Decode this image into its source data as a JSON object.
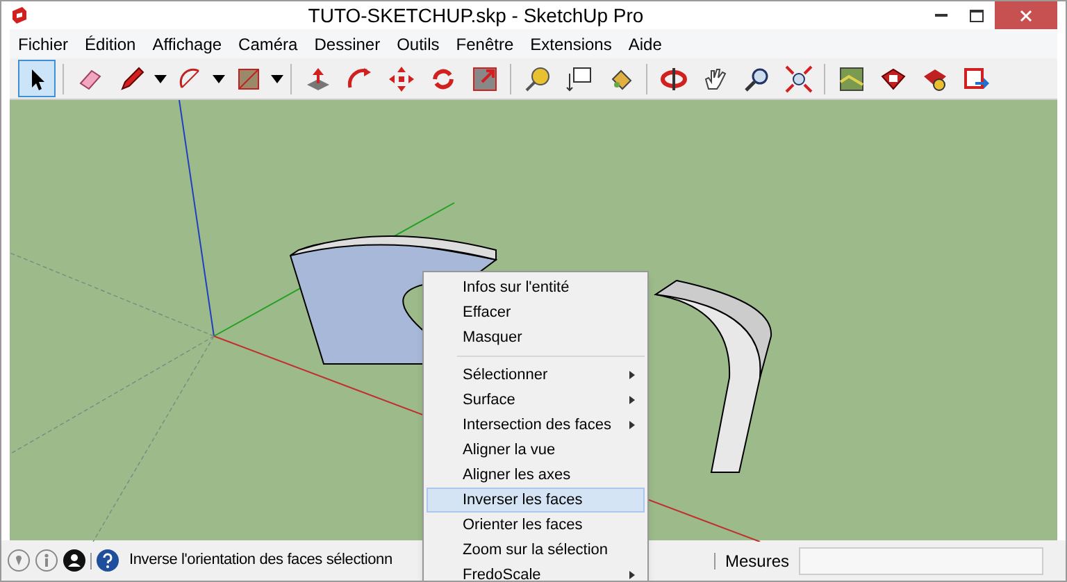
{
  "window": {
    "title": "TUTO-SKETCHUP.skp - SketchUp Pro"
  },
  "menu_bar": [
    "Fichier",
    "Édition",
    "Affichage",
    "Caméra",
    "Dessiner",
    "Outils",
    "Fenêtre",
    "Extensions",
    "Aide"
  ],
  "toolbar": [
    {
      "kind": "select",
      "selected": true
    },
    {
      "kind": "sep"
    },
    {
      "kind": "eraser",
      "selected": false
    },
    {
      "kind": "pencil",
      "selected": false
    },
    {
      "kind": "dropdown"
    },
    {
      "kind": "arc",
      "selected": false
    },
    {
      "kind": "dropdown"
    },
    {
      "kind": "rectangle",
      "selected": false
    },
    {
      "kind": "dropdown"
    },
    {
      "kind": "sep"
    },
    {
      "kind": "pushpull",
      "selected": false
    },
    {
      "kind": "followme",
      "selected": false
    },
    {
      "kind": "move",
      "selected": false
    },
    {
      "kind": "rotate",
      "selected": false
    },
    {
      "kind": "scale",
      "selected": false
    },
    {
      "kind": "sep"
    },
    {
      "kind": "tape",
      "selected": false
    },
    {
      "kind": "text",
      "selected": false
    },
    {
      "kind": "paint",
      "selected": false
    },
    {
      "kind": "sep"
    },
    {
      "kind": "orbit",
      "selected": false
    },
    {
      "kind": "pan",
      "selected": false
    },
    {
      "kind": "zoom",
      "selected": false
    },
    {
      "kind": "extents",
      "selected": false
    },
    {
      "kind": "sep"
    },
    {
      "kind": "map",
      "selected": false
    },
    {
      "kind": "warehouse",
      "selected": false
    },
    {
      "kind": "extension",
      "selected": false
    },
    {
      "kind": "share",
      "selected": false
    }
  ],
  "context_menu": [
    {
      "kind": "item",
      "label": "Infos sur l'entité",
      "submenu": false,
      "selected": false
    },
    {
      "kind": "item",
      "label": "Effacer",
      "submenu": false,
      "selected": false
    },
    {
      "kind": "item",
      "label": "Masquer",
      "submenu": false,
      "selected": false
    },
    {
      "kind": "separator"
    },
    {
      "kind": "item",
      "label": "Sélectionner",
      "submenu": true,
      "selected": false
    },
    {
      "kind": "item",
      "label": "Surface",
      "submenu": true,
      "selected": false
    },
    {
      "kind": "item",
      "label": "Intersection des faces",
      "submenu": true,
      "selected": false
    },
    {
      "kind": "item",
      "label": "Aligner la vue",
      "submenu": false,
      "selected": false
    },
    {
      "kind": "item",
      "label": "Aligner les axes",
      "submenu": false,
      "selected": false
    },
    {
      "kind": "item",
      "label": "Inverser les faces",
      "submenu": false,
      "selected": true
    },
    {
      "kind": "item",
      "label": "Orienter les faces",
      "submenu": false,
      "selected": false
    },
    {
      "kind": "item",
      "label": "Zoom sur la sélection",
      "submenu": false,
      "selected": false
    },
    {
      "kind": "item",
      "label": "FredoScale",
      "submenu": true,
      "selected": false
    }
  ],
  "status_bar": {
    "message": "Inverse l'orientation des faces sélectionn",
    "measure_label": "Mesures"
  }
}
